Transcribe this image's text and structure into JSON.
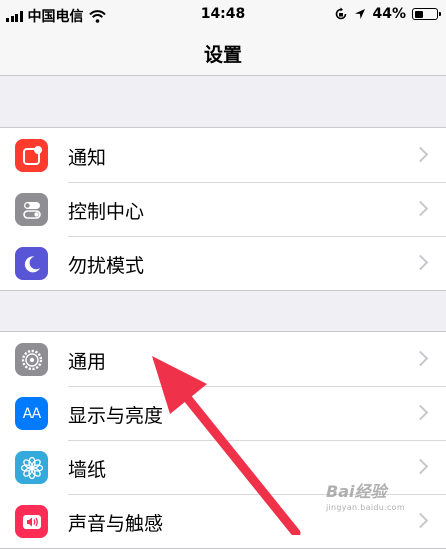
{
  "status_bar": {
    "carrier": "中国电信",
    "time": "14:48",
    "battery_text": "44%",
    "battery_level": 0.44
  },
  "nav_bar": {
    "title": "设置"
  },
  "groups": [
    {
      "items": [
        {
          "label": "通知",
          "icon": "notification-icon",
          "icon_color": "#ff3b30"
        },
        {
          "label": "控制中心",
          "icon": "control-center-icon",
          "icon_color": "#8e8e93"
        },
        {
          "label": "勿扰模式",
          "icon": "moon-icon",
          "icon_color": "#5856d6"
        }
      ]
    },
    {
      "items": [
        {
          "label": "通用",
          "icon": "gear-icon",
          "icon_color": "#8e8e93"
        },
        {
          "label": "显示与亮度",
          "icon": "display-brightness-icon",
          "icon_color": "#007aff",
          "icon_text": "AA"
        },
        {
          "label": "墙纸",
          "icon": "wallpaper-flower-icon",
          "icon_color": "#34aadc"
        },
        {
          "label": "声音与触感",
          "icon": "speaker-icon",
          "icon_color": "#ff2d55"
        }
      ]
    }
  ],
  "annotation": {
    "arrow_color": "#f0314a"
  },
  "watermark": {
    "brand": "Bai经验",
    "url": "jingyan.baidu.com"
  }
}
